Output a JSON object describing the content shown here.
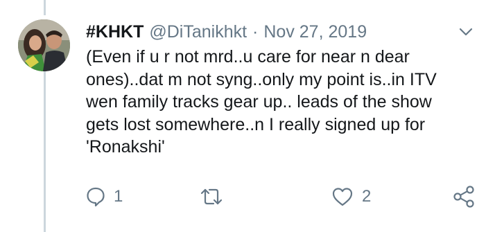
{
  "tweet": {
    "display_name": "#KHKT",
    "handle": "@DiTanikhkt",
    "separator": "·",
    "date": "Nov 27, 2019",
    "text": "(Even if u r not mrd..u care for near n dear\nones)..dat m not syng..only my point is..in ITV\nwen family tracks gear up.. leads of the show\ngets lost somewhere..n I really signed up for\n'Ronakshi'"
  },
  "actions": {
    "reply_count": "1",
    "retweet_count": "",
    "like_count": "2"
  },
  "icons": {
    "reply": "comment-bubble-icon",
    "retweet": "retweet-icon",
    "like": "heart-icon",
    "share": "share-icon",
    "menu": "chevron-down-icon"
  },
  "colors": {
    "text": "#14171a",
    "secondary": "#657786",
    "thread_line": "#ccd6dd"
  }
}
